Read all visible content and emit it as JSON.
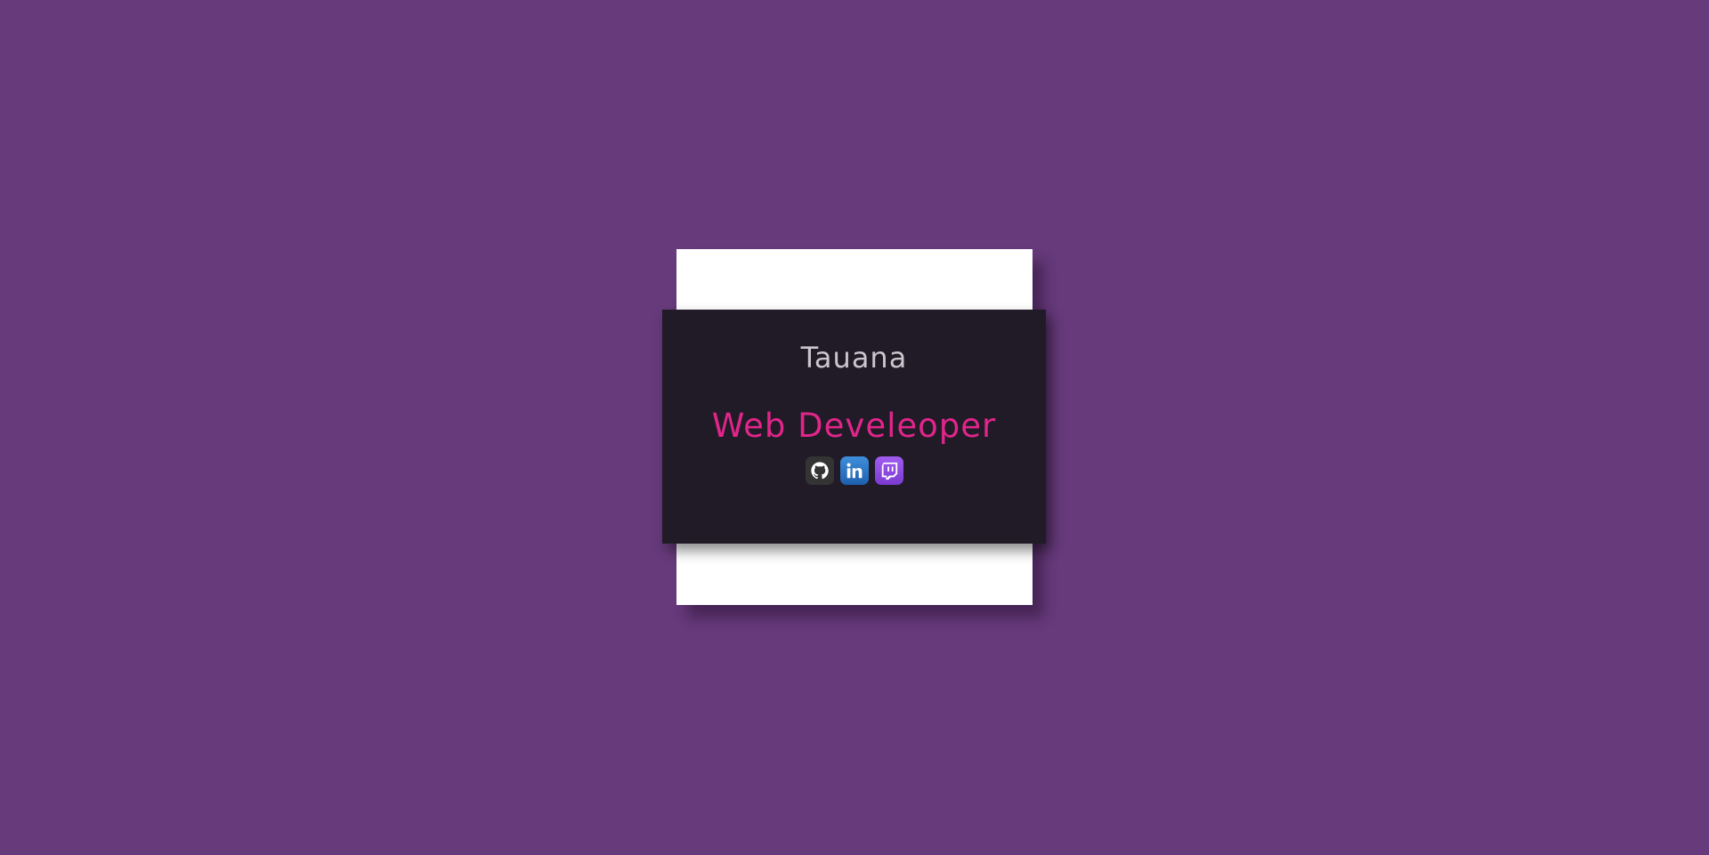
{
  "card": {
    "name": "Tauana",
    "role": "Web Develeoper"
  },
  "socials": [
    {
      "icon": "github-icon",
      "color": "#343434"
    },
    {
      "icon": "linkedin-icon",
      "color": "#2a6fc0"
    },
    {
      "icon": "twitch-icon",
      "color": "#8e4ce6"
    }
  ],
  "colors": {
    "background": "#663a7b",
    "card": "#201b27",
    "paper": "#ffffff",
    "name": "#c9c6cd",
    "role": "#e1258a"
  }
}
